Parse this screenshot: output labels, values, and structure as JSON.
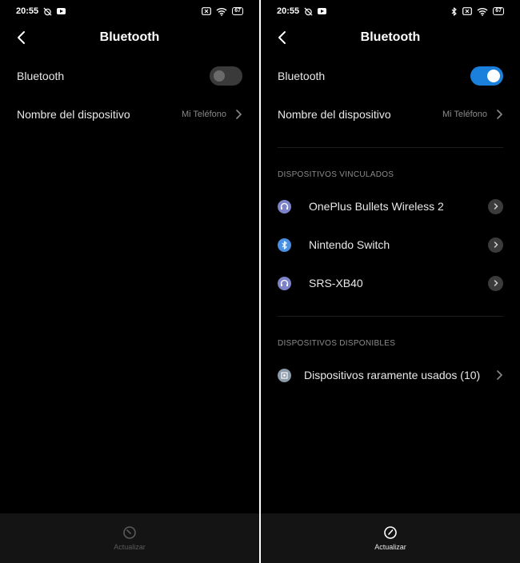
{
  "left": {
    "status": {
      "time": "20:55",
      "battery": "67"
    },
    "header": {
      "title": "Bluetooth"
    },
    "bluetooth_row": {
      "label": "Bluetooth",
      "enabled": false
    },
    "device_name_row": {
      "label": "Nombre del dispositivo",
      "value": "Mi Teléfono"
    },
    "bottom": {
      "label": "Actualizar"
    }
  },
  "right": {
    "status": {
      "time": "20:55",
      "battery": "67"
    },
    "header": {
      "title": "Bluetooth"
    },
    "bluetooth_row": {
      "label": "Bluetooth",
      "enabled": true
    },
    "device_name_row": {
      "label": "Nombre del dispositivo",
      "value": "Mi Teléfono"
    },
    "paired_section": {
      "title": "DISPOSITIVOS VINCULADOS",
      "devices": [
        {
          "name": "OnePlus Bullets Wireless 2",
          "icon": "headphones-icon"
        },
        {
          "name": "Nintendo Switch",
          "icon": "bluetooth-icon"
        },
        {
          "name": "SRS-XB40",
          "icon": "headphones-icon"
        }
      ]
    },
    "available_section": {
      "title": "DISPOSITIVOS DISPONIBLES",
      "rare_devices": {
        "label": "Dispositivos raramente usados (10)",
        "icon": "device-icon"
      }
    },
    "bottom": {
      "label": "Actualizar"
    }
  },
  "colors": {
    "accent": "#1b7fdc",
    "background": "#000000",
    "bottom_bar": "#141414"
  }
}
